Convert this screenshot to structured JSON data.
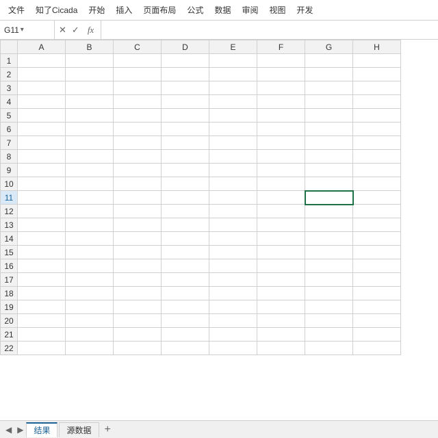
{
  "menubar": {
    "items": [
      "文件",
      "知了Cicada",
      "开始",
      "插入",
      "页面布局",
      "公式",
      "数据",
      "审阅",
      "视图",
      "开发"
    ]
  },
  "formulabar": {
    "cell_ref": "G11",
    "dropdown_icon": "▾",
    "cancel_icon": "✕",
    "confirm_icon": "✓",
    "fx_label": "fx",
    "formula_value": ""
  },
  "grid": {
    "columns": [
      "A",
      "B",
      "C",
      "D",
      "E",
      "F",
      "G",
      "H"
    ],
    "rows": 22,
    "active_cell": "G11"
  },
  "sheet_tabs": {
    "nav_prev": "◀",
    "nav_next": "▶",
    "tabs": [
      {
        "label": "结果",
        "active": true
      },
      {
        "label": "源数据",
        "active": false
      }
    ],
    "add_label": "+"
  }
}
